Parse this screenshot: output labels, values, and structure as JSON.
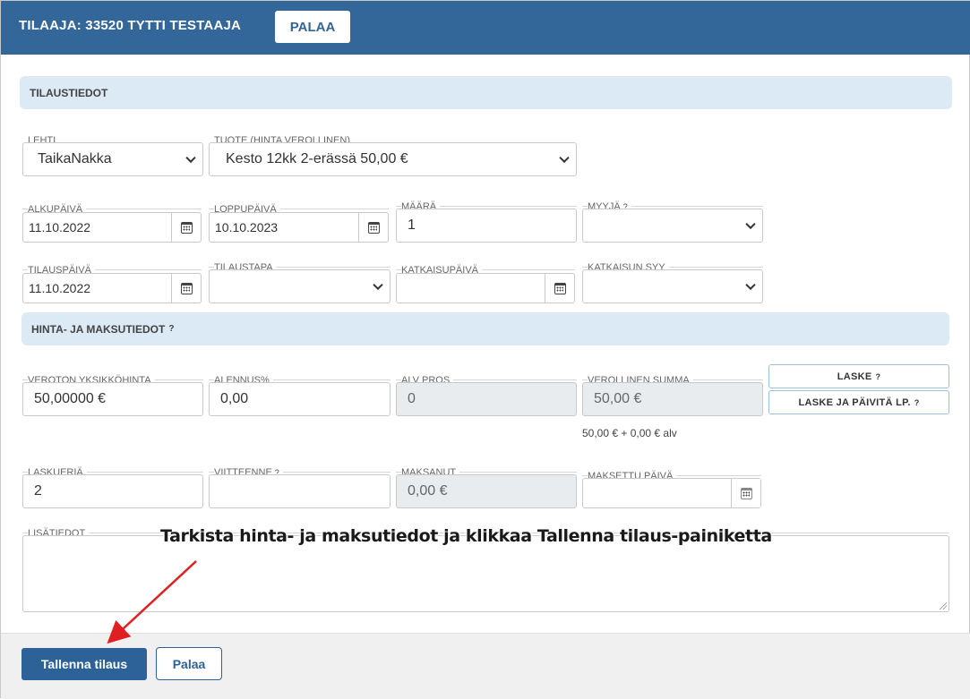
{
  "header": {
    "title": "TILAAJA: 33520 TYTTI TESTAAJA",
    "back_label": "PALAA"
  },
  "sections": {
    "order_info": "TILAUSTIEDOT",
    "price_info": "HINTA- JA MAKSUTIEDOT",
    "help_icon": "?"
  },
  "fields": {
    "lehti": {
      "label": "LEHTI",
      "value": "TaikaNakka"
    },
    "tuote": {
      "label": "TUOTE (HINTA VEROLLINEN)",
      "value": "Kesto 12kk 2-erässä 50,00 €"
    },
    "alkupaiva": {
      "label": "ALKUPÄIVÄ",
      "value": "11.10.2022"
    },
    "loppupaiva": {
      "label": "LOPPUPÄIVÄ",
      "value": "10.10.2023"
    },
    "maara": {
      "label": "MÄÄRÄ",
      "value": "1"
    },
    "myyja": {
      "label": "MYYJÄ",
      "value": ""
    },
    "tilauspaiva": {
      "label": "TILAUSPÄIVÄ",
      "value": "11.10.2022"
    },
    "tilaustapa": {
      "label": "TILAUSTAPA",
      "value": ""
    },
    "katkaisupaiva": {
      "label": "KATKAISUPÄIVÄ",
      "value": ""
    },
    "katkaisun_syy": {
      "label": "KATKAISUN SYY",
      "value": ""
    },
    "veroton": {
      "label": "VEROTON YKSIKKÖHINTA",
      "value": "50,00000 €"
    },
    "alennus": {
      "label": "ALENNUS%",
      "value": "0,00"
    },
    "alv": {
      "label": "ALV PROS",
      "value": "0"
    },
    "verollinen": {
      "label": "VEROLLINEN SUMMA",
      "value": "50,00 €"
    },
    "laskueria": {
      "label": "LASKUERIÄ",
      "value": "2"
    },
    "viitteenne": {
      "label": "VIITTEENNE",
      "value": ""
    },
    "maksanut": {
      "label": "MAKSANUT",
      "value": "0,00 €"
    },
    "maksettu_paiva": {
      "label": "MAKSETTU PÄIVÄ",
      "value": ""
    },
    "lisatiedot": {
      "label": "LISÄTIEDOT",
      "value": ""
    }
  },
  "buttons": {
    "laske": "LASKE",
    "laske_paivita": "LASKE JA PÄIVITÄ LP.",
    "save": "Tallenna tilaus",
    "back": "Palaa"
  },
  "sum_note": "50,00 € + 0,00 € alv",
  "annotation": "Tarkista hinta- ja maksutiedot ja klikkaa Tallenna tilaus-painiketta",
  "colors": {
    "header_bg": "#336699",
    "section_bg": "#dbeaf5",
    "save_bg": "#2d6298",
    "arrow": "#e02020"
  }
}
